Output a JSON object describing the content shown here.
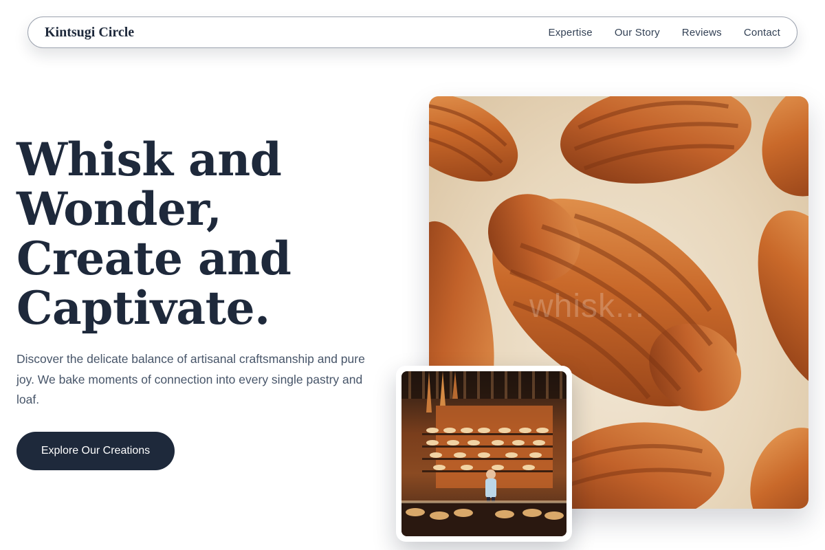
{
  "brand": {
    "name": "Kintsugi Circle"
  },
  "nav": {
    "links": [
      "Expertise",
      "Our Story",
      "Reviews",
      "Contact"
    ]
  },
  "hero": {
    "title_lines": [
      "Whisk and",
      "Wonder,",
      "Create and",
      "Captivate."
    ],
    "description": "Discover the delicate balance of artisanal craftsmanship and pure joy. We bake moments of connection into every single pastry and loaf.",
    "cta_label": "Explore Our Creations"
  },
  "media": {
    "main_photo": {
      "subject": "croissants-on-parchment",
      "watermark": "whisk..."
    },
    "inset_photo": {
      "subject": "bakery-display-counter"
    }
  },
  "colors": {
    "ink": "#1e293b",
    "body_text": "#475569",
    "button_bg": "#1e293b",
    "button_text": "#ffffff",
    "background": "#ffffff"
  }
}
